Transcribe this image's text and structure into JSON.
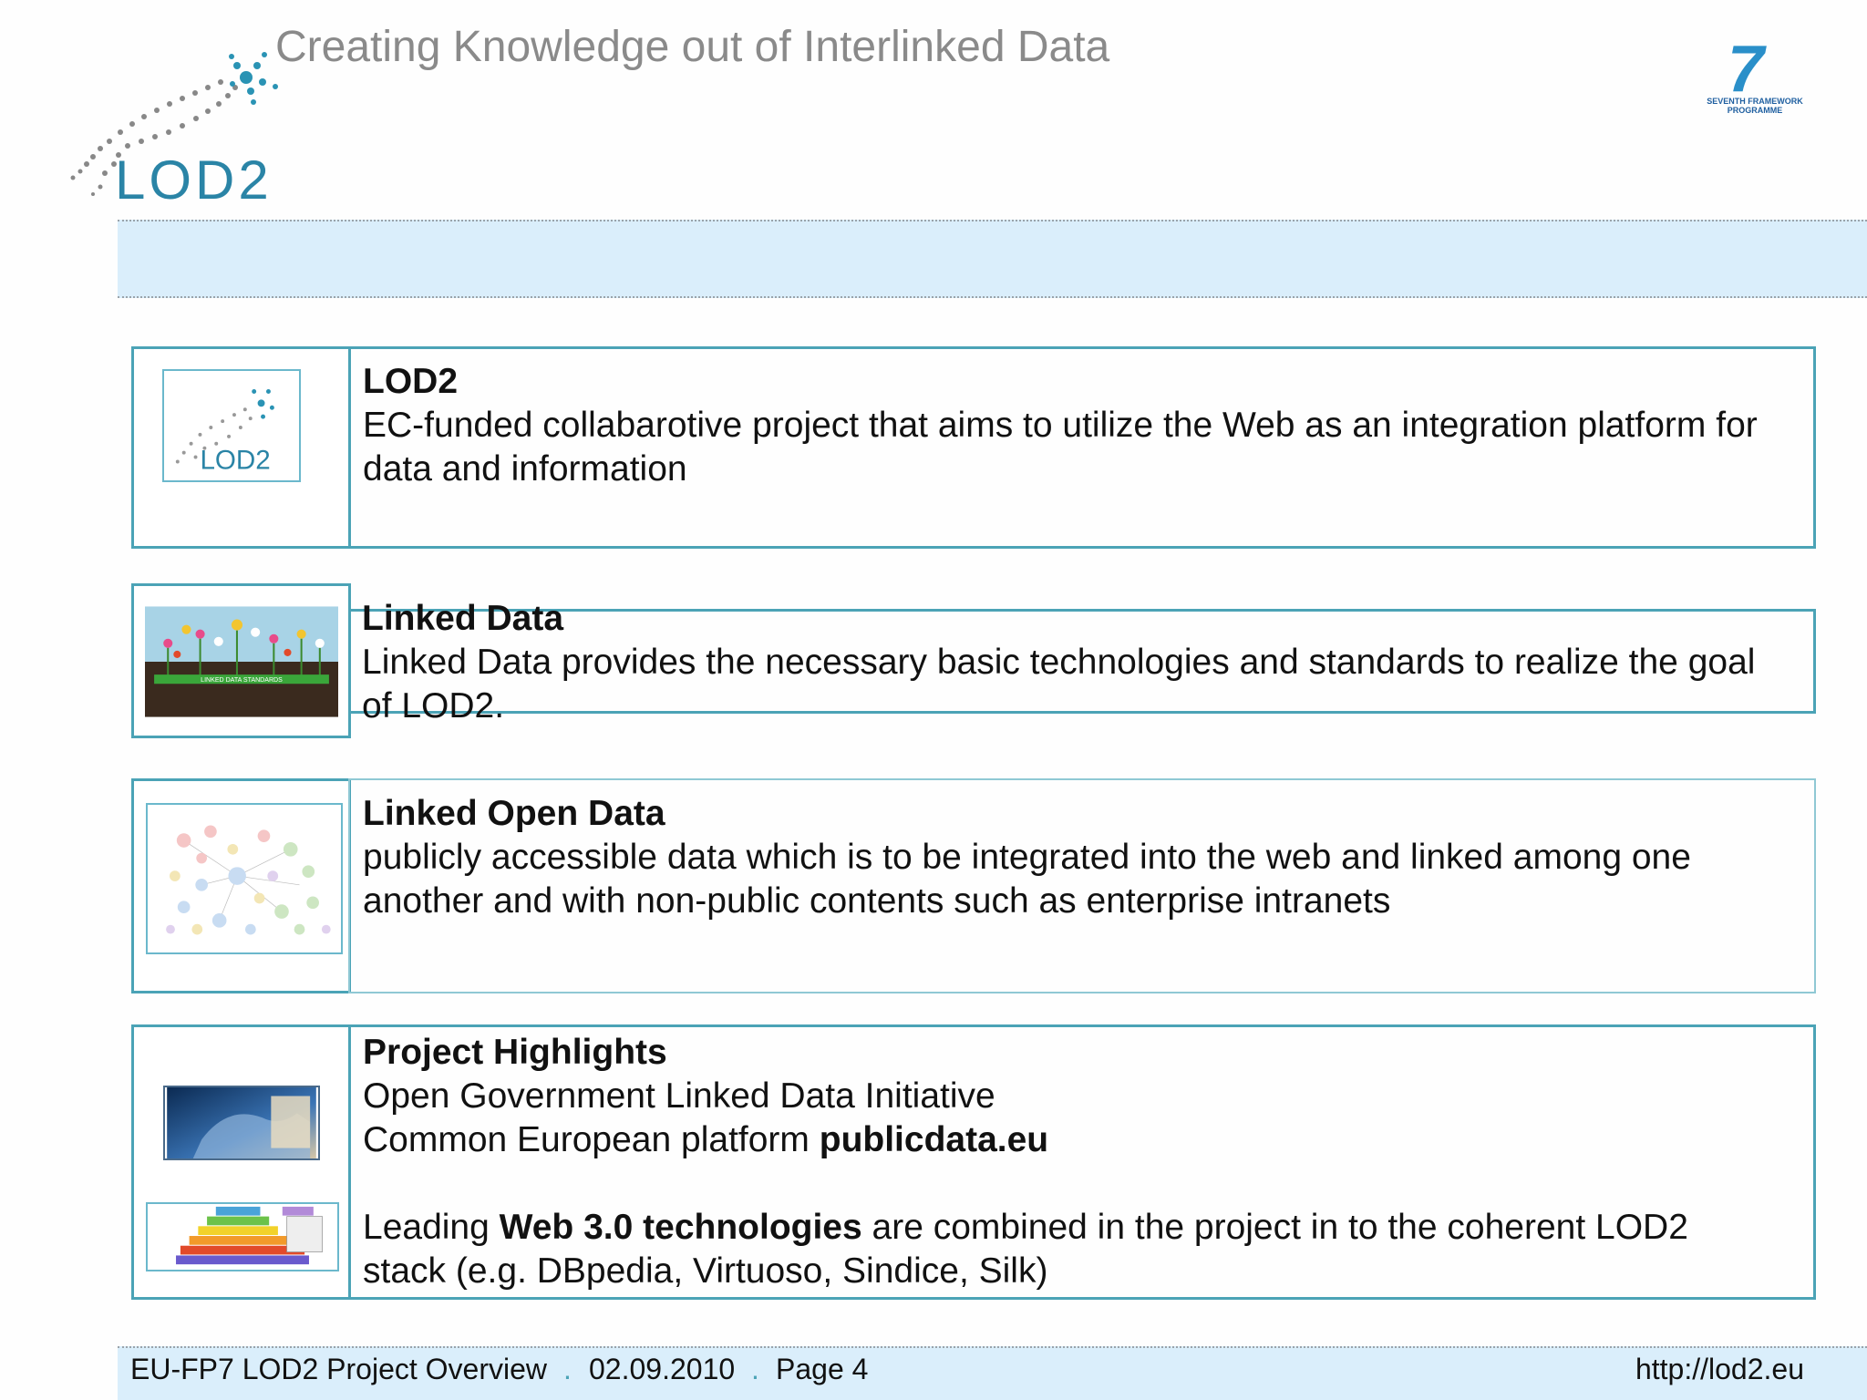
{
  "header": {
    "tagline": "Creating Knowledge out of Interlinked Data",
    "logo_text": "LOD2",
    "fp7_logo_number": "7",
    "fp7_logo_text_1": "SEVENTH FRAMEWORK",
    "fp7_logo_text_2": "PROGRAMME"
  },
  "colors": {
    "accent": "#4ba3b6",
    "band": "#daeefb",
    "tagline": "#8a8a8a"
  },
  "sections": [
    {
      "heading": "LOD2",
      "lines": [
        "EC-funded collabarotive project that aims to utilize the Web as an integration platform for",
        "data and information"
      ],
      "thumb_text": "LOD2"
    },
    {
      "heading": "Linked Data",
      "lines": [
        "Linked Data provides the necessary basic technologies and standards to realize the goal",
        "of LOD2."
      ],
      "thumb_text": "LINKED DATA STANDARDS"
    },
    {
      "heading": "Linked Open Data",
      "lines": [
        "publicly accessible data which is to be integrated into the web and linked among one",
        "another and with non-public contents such as enterprise intranets"
      ]
    },
    {
      "heading": "Project Highlights",
      "line1": "Open Government Linked Data Initiative",
      "line2_pre": "Common European platform ",
      "line2_bold": "publicdata.eu",
      "line3_pre": "Leading ",
      "line3_bold": "Web 3.0 technologies",
      "line3_post": " are combined in the project in to the coherent LOD2",
      "line4": "stack (e.g. DBpedia, Virtuoso, Sindice, Silk)"
    }
  ],
  "footer": {
    "project": "EU-FP7 LOD2 Project Overview",
    "sep": ".",
    "date": "02.09.2010",
    "page": "Page 4",
    "url": "http://lod2.eu"
  }
}
